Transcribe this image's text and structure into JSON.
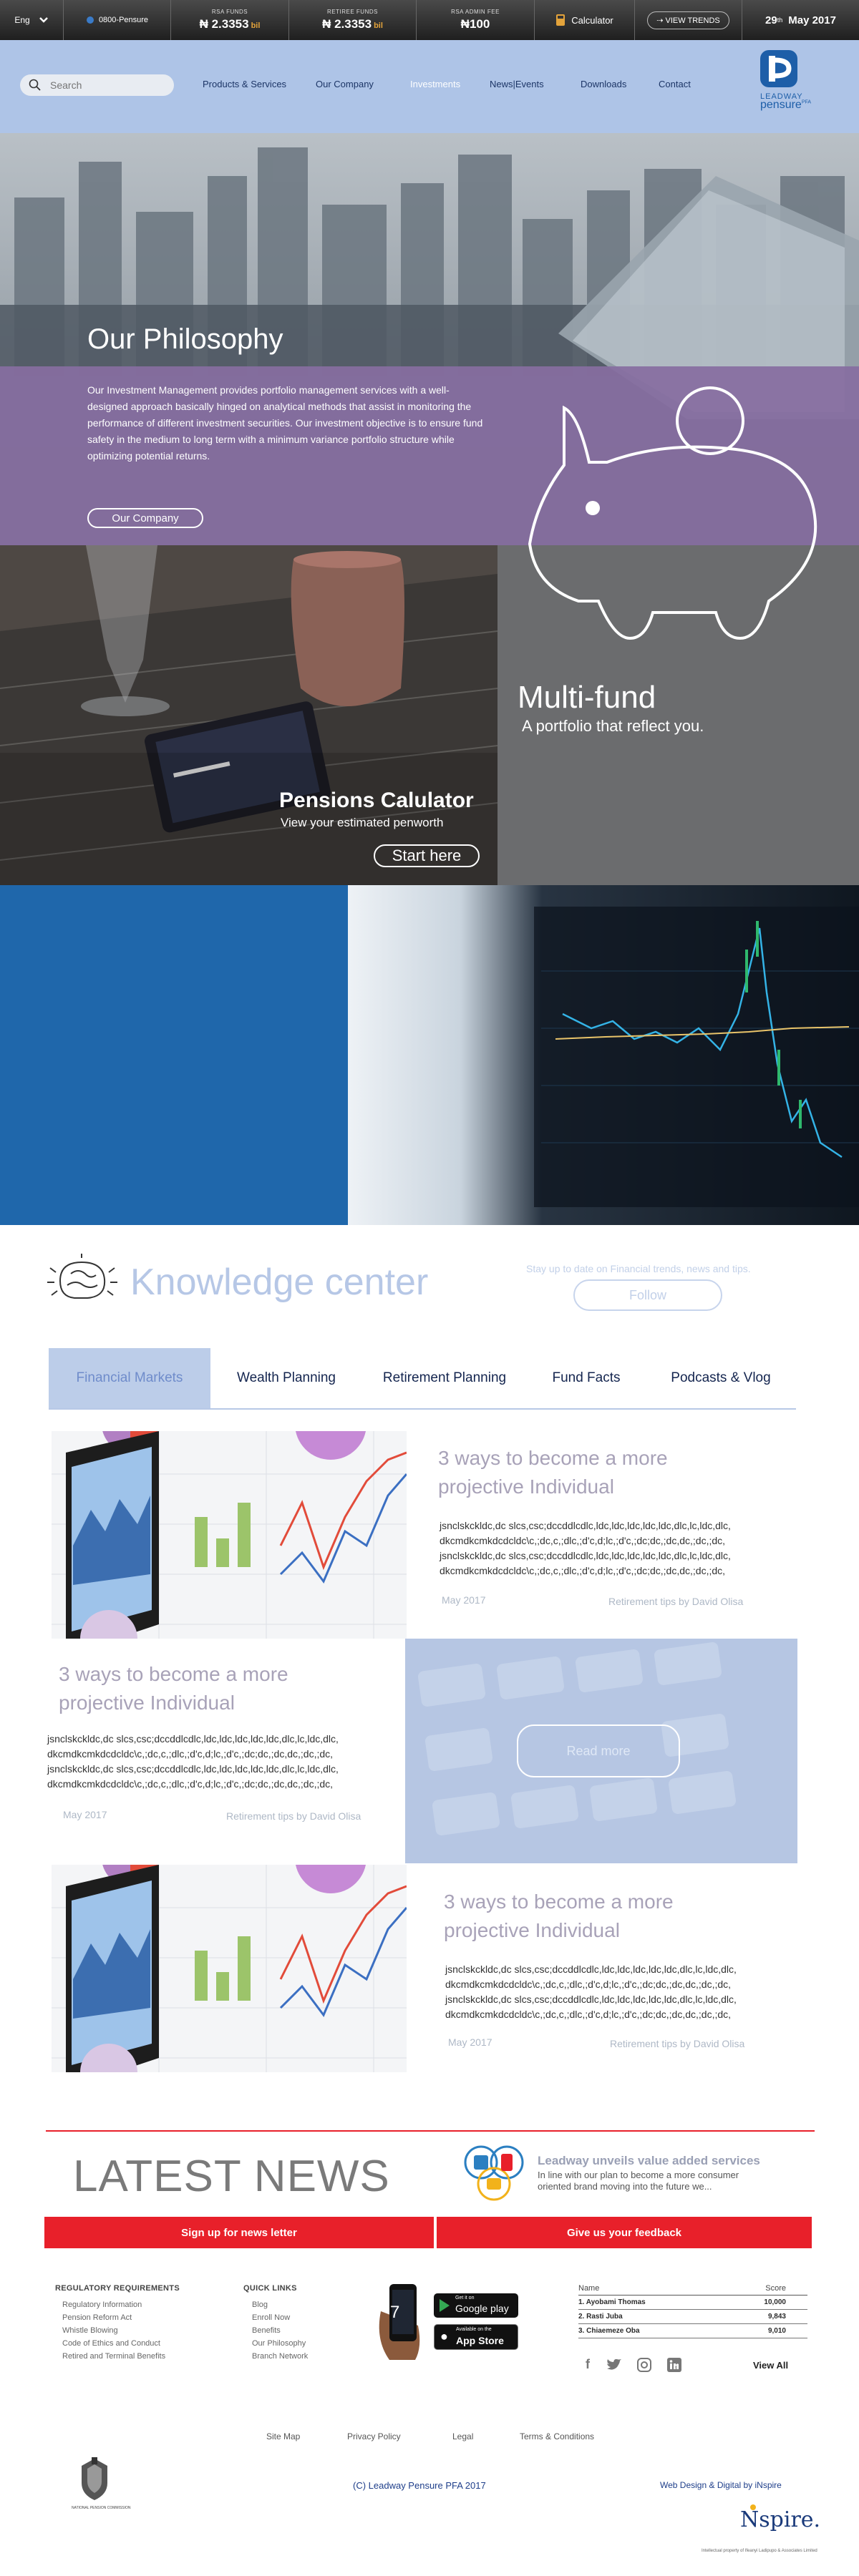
{
  "ticker": {
    "language": "Eng",
    "phone": "0800-Pensure",
    "rsa_funds_label": "RSA FUNDS",
    "rsa_funds_value": "₦ 2.3353",
    "rsa_funds_unit": "bil",
    "retiree_funds_label": "RETIREE FUNDS",
    "retiree_funds_value": "₦ 2.3353",
    "retiree_funds_unit": "bil",
    "rsa_admin_fee_label": "RSA ADMIN FEE",
    "rsa_admin_fee_value": "₦100",
    "calculator": "Calculator",
    "view_trends": "VIEW TRENDS",
    "date_day": "29",
    "date_suffix": "th",
    "date_rest": "May 2017"
  },
  "header": {
    "search_placeholder": "Search",
    "nav": [
      "Products & Services",
      "Our Company",
      "Investments",
      "News|Events",
      "Downloads",
      "Contact"
    ],
    "active_nav": "Investments",
    "logo_line1": "LEADWAY",
    "logo_line2": "pensure",
    "logo_suffix": "PFA"
  },
  "philosophy": {
    "title": "Our Philosophy",
    "body": "Our Investment Management provides portfolio management services with a well-designed approach basically hinged on analytical methods that assist in monitoring the performance of different investment securities. Our investment objective is to ensure fund safety in the medium to long term with a minimum variance portfolio structure while optimizing potential returns.",
    "button": "Our Company"
  },
  "pensions": {
    "title": "Pensions Calulator",
    "subtitle": "View your estimated penworth",
    "button": "Start here"
  },
  "multifund": {
    "title": "Multi-fund",
    "subtitle": "A portfolio that reflect you."
  },
  "knowledge": {
    "title": "Knowledge center",
    "tagline": "Stay up to date on Financial trends, news and tips.",
    "follow": "Follow",
    "tabs": [
      "Financial Markets",
      "Wealth Planning",
      "Retirement Planning",
      "Fund Facts",
      "Podcasts & Vlog"
    ],
    "active_tab": "Financial Markets",
    "read_more": "Read more",
    "articles": [
      {
        "title": "3 ways to become a more projective Individual",
        "body": "jsnclskckldc,dc slcs,csc;dccddlcdlc,ldc,ldc,ldc,ldc,ldc,dlc,lc,ldc,dlc, dkcmdkcmkdcdcldc\\c,;dc,c,;dlc,;d'c,d;lc,;d'c,;dc;dc,;dc,dc,;dc,;dc, jsnclskckldc,dc slcs,csc;dccddlcdlc,ldc,ldc,ldc,ldc,ldc,dlc,lc,ldc,dlc, dkcmdkcmkdcdcldc\\c,;dc,c,;dlc,;d'c,d;lc,;d'c,;dc;dc,;dc,dc,;dc,;dc,",
        "date": "May 2017",
        "tag": "Retirement tips by David Olisa"
      },
      {
        "title": "3 ways to become a more projective Individual",
        "body": "jsnclskckldc,dc slcs,csc;dccddlcdlc,ldc,ldc,ldc,ldc,ldc,dlc,lc,ldc,dlc, dkcmdkcmkdcdcldc\\c,;dc,c,;dlc,;d'c,d;lc,;d'c,;dc;dc,;dc,dc,;dc,;dc, jsnclskckldc,dc slcs,csc;dccddlcdlc,ldc,ldc,ldc,ldc,ldc,dlc,lc,ldc,dlc, dkcmdkcmkdcdcldc\\c,;dc,c,;dlc,;d'c,d;lc,;d'c,;dc;dc,;dc,dc,;dc,;dc,",
        "date": "May 2017",
        "tag": "Retirement tips by David Olisa"
      },
      {
        "title": "3 ways to become a more projective Individual",
        "body": "jsnclskckldc,dc slcs,csc;dccddlcdlc,ldc,ldc,ldc,ldc,ldc,dlc,lc,ldc,dlc, dkcmdkcmkdcdcldc\\c,;dc,c,;dlc,;d'c,d;lc,;d'c,;dc;dc,;dc,dc,;dc,;dc, jsnclskckldc,dc slcs,csc;dccddlcdlc,ldc,ldc,ldc,ldc,ldc,dlc,lc,ldc,dlc, dkcmdkcmkdcdcldc\\c,;dc,c,;dlc,;d'c,d;lc,;d'c,;dc;dc,;dc,dc,;dc,;dc,",
        "date": "May 2017",
        "tag": "Retirement tips by David Olisa"
      }
    ]
  },
  "news": {
    "title": "LATEST NEWS",
    "headline": "Leadway unveils value added services",
    "summary": "In line with our plan to become a more consumer oriented brand moving into the future we...",
    "newsletter": "Sign up for news letter",
    "feedback": "Give us your feedback"
  },
  "footer": {
    "regulatory_title": "REGULATORY REQUIREMENTS",
    "regulatory_links": [
      "Regulatory Information",
      "Pension Reform Act",
      "Whistle Blowing",
      "Code of Ethics and Conduct",
      "Retired and Terminal Benefits"
    ],
    "quick_title": "QUICK LINKS",
    "quick_links": [
      "Blog",
      "Enroll Now",
      "Benefits",
      "Our Philosophy",
      "Branch Network"
    ],
    "google_play_top": "Get it on",
    "google_play": "Google play",
    "app_store_top": "Available on the",
    "app_store": "App Store",
    "phone_screen": "7",
    "leaderboard_name_header": "Name",
    "leaderboard_score_header": "Score",
    "leaderboard": [
      {
        "name": "1. Ayobami Thomas",
        "score": "10,000"
      },
      {
        "name": "2. Rasti Juba",
        "score": "9,843"
      },
      {
        "name": "3. Chiaemeze Oba",
        "score": "9,010"
      }
    ],
    "view_all": "View All",
    "bottom_links": [
      "Site Map",
      "Privacy Policy",
      "Legal",
      "Terms & Conditions"
    ],
    "copyright": "(C) Leadway Pensure PFA 2017",
    "credit": "Web Design & Digital by iNspire",
    "pencom_label": "NATIONAL PENSION COMMISSION",
    "inspire_logo": "Nspire.",
    "inspire_tagline": "Intellectual property of Ifeanyi Ladipupo & Associates Limited"
  },
  "colors": {
    "header_bg": "#aec4e7",
    "purple_band": "#876ea0",
    "blue_box": "#1f67ab",
    "news_red": "#e8202a",
    "active_tab_bg": "#bccde9"
  }
}
